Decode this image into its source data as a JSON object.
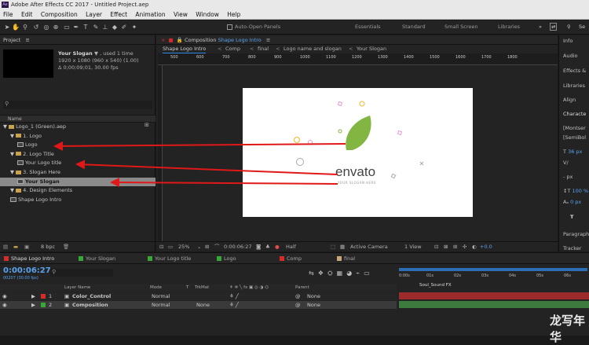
{
  "app": {
    "title": "Adobe After Effects CC 2017 - Untitled Project.aep",
    "icon_label": "Ae"
  },
  "menu": [
    "File",
    "Edit",
    "Composition",
    "Layer",
    "Effect",
    "Animation",
    "View",
    "Window",
    "Help"
  ],
  "toolbar": {
    "auto_open": "Auto-Open Panels",
    "workspaces": [
      "Essentials",
      "Standard",
      "Small Screen",
      "Libraries"
    ],
    "search": "Se"
  },
  "project": {
    "title": "Project",
    "comp_name": "Your Slogan",
    "used": "▼ , used 1 time",
    "dims": "1920 x 1080 (960 x 540) (1.00)",
    "duration": "Δ 0;00;09;01, 30.00 fps",
    "search_placeholder": "",
    "col_name": "Name",
    "items": [
      {
        "label": "Logo_1 (Green).aep",
        "type": "folder",
        "indent": 0
      },
      {
        "label": "1. Logo",
        "type": "folder",
        "indent": 1
      },
      {
        "label": "Logo",
        "type": "comp",
        "indent": 2
      },
      {
        "label": "2. Logo Title",
        "type": "folder",
        "indent": 1
      },
      {
        "label": "Your Logo title",
        "type": "comp",
        "indent": 2
      },
      {
        "label": "3. Slogan Here",
        "type": "folder",
        "indent": 1
      },
      {
        "label": "Your Slogan",
        "type": "comp",
        "indent": 2,
        "selected": true
      },
      {
        "label": "4. Design Elements",
        "type": "folder",
        "indent": 1
      },
      {
        "label": "Shape Logo Intro",
        "type": "comp",
        "indent": 1
      }
    ],
    "bpc": "8 bpc"
  },
  "comp": {
    "title_prefix": "Composition",
    "title_name": "Shape Logo Intro",
    "breadcrumbs": [
      "Shape Logo Intro",
      "Comp",
      "final",
      "Logo name and slogan",
      "Your Slogan"
    ],
    "ruler": [
      "500",
      "600",
      "700",
      "800",
      "900",
      "1000",
      "1100",
      "1200",
      "1300",
      "1400",
      "1500",
      "1600",
      "1700",
      "1800"
    ],
    "logo_word": "envato",
    "slogan": "YOUR SLOGAN HERE",
    "footer": {
      "zoom": "25%",
      "timecode": "0:00:06:27",
      "resolution": "Half",
      "camera": "Active Camera",
      "view": "1 View",
      "exposure": "+0.0"
    }
  },
  "right": {
    "items": [
      "Info",
      "Audio",
      "Effects &",
      "Libraries",
      "Align",
      "Characte",
      "[Montser",
      "[SemiBol",
      "36 px",
      "px",
      "- px",
      "100 %",
      "0 px",
      "T",
      "Paragraph",
      "Tracker"
    ]
  },
  "timeline": {
    "tabs": [
      {
        "label": "Shape Logo Intro",
        "color": "#d62b2b",
        "active": true
      },
      {
        "label": "Your Slogan",
        "color": "#3aa63a"
      },
      {
        "label": "Your Logo title",
        "color": "#3aa63a"
      },
      {
        "label": "Logo",
        "color": "#3aa63a"
      },
      {
        "label": "Comp",
        "color": "#d62b2b"
      },
      {
        "label": "final",
        "color": "#c8a67a"
      }
    ],
    "timecode": "0:00:06:27",
    "frame": "00207 (30.00 fps)",
    "cols": {
      "layer": "Layer Name",
      "mode": "Mode",
      "t": "T",
      "trkmat": "TrkMat",
      "parent": "Parent"
    },
    "layers": [
      {
        "num": "1",
        "name": "Color_Control",
        "color": "#d62b2b",
        "mode": "Normal",
        "trk": "",
        "parent": "None"
      },
      {
        "num": "2",
        "name": "Composition",
        "color": "#3aa63a",
        "mode": "Normal",
        "trk": "None",
        "parent": "None"
      }
    ],
    "ruler": [
      "0:00s",
      "01s",
      "02s",
      "03s",
      "04s",
      "05s",
      "06s"
    ],
    "marker": "Soul_Sound FX"
  },
  "watermark": "龙写年华",
  "colors": {
    "accent": "#2d8ceb",
    "arrow": "#e01818",
    "leaf": "#82b541"
  }
}
